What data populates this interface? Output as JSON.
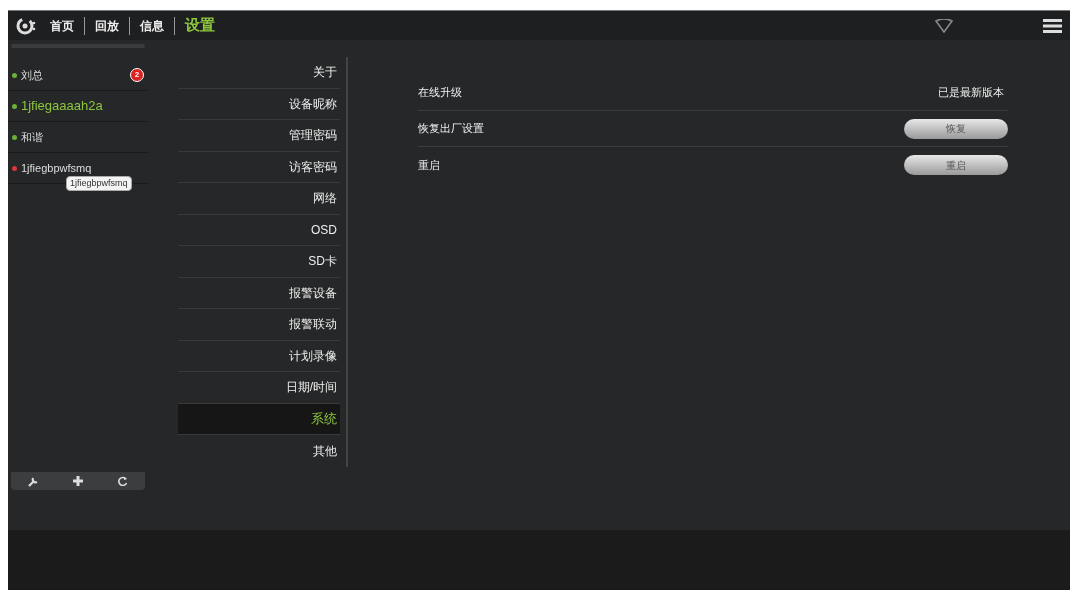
{
  "nav": {
    "tabs": [
      {
        "label": "首页",
        "selected": false
      },
      {
        "label": "回放",
        "selected": false
      },
      {
        "label": "信息",
        "selected": false
      },
      {
        "label": "设置",
        "selected": true
      }
    ]
  },
  "devices": [
    {
      "name": "刘总",
      "color": "#6bb03a",
      "selected": false,
      "badge": "2"
    },
    {
      "name": "1jfiegaaaah2a",
      "color": "#6bb03a",
      "selected": true
    },
    {
      "name": "和谐",
      "color": "#6bb03a",
      "selected": false
    },
    {
      "name": "1jfiegbpwfsmq",
      "color": "#d9383a",
      "selected": false
    }
  ],
  "tooltip": "1jfiegbpwfsmq",
  "settings_menu": [
    {
      "label": "关于",
      "selected": false
    },
    {
      "label": "设备昵称",
      "selected": false
    },
    {
      "label": "管理密码",
      "selected": false
    },
    {
      "label": "访客密码",
      "selected": false
    },
    {
      "label": "网络",
      "selected": false
    },
    {
      "label": "OSD",
      "selected": false
    },
    {
      "label": "SD卡",
      "selected": false
    },
    {
      "label": "报警设备",
      "selected": false
    },
    {
      "label": "报警联动",
      "selected": false
    },
    {
      "label": "计划录像",
      "selected": false
    },
    {
      "label": "日期/时间",
      "selected": false
    },
    {
      "label": "系统",
      "selected": true
    },
    {
      "label": "其他",
      "selected": false
    }
  ],
  "system_rows": [
    {
      "kind": "status",
      "label": "在线升级",
      "value": "已是最新版本"
    },
    {
      "kind": "button",
      "label": "恢复出厂设置",
      "value": "恢复"
    },
    {
      "kind": "button",
      "label": "重启",
      "value": "重启"
    }
  ]
}
